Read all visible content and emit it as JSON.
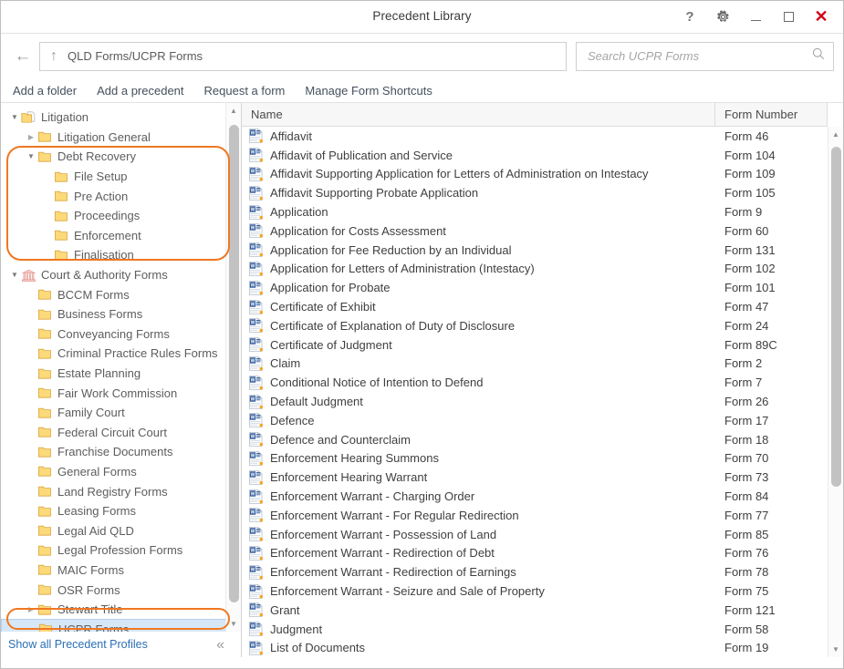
{
  "window": {
    "title": "Precedent Library",
    "buttons": [
      {
        "name": "help",
        "glyph": "?"
      },
      {
        "name": "settings",
        "glyph": "gear"
      },
      {
        "name": "minimize",
        "glyph": "minimize"
      },
      {
        "name": "maximize",
        "glyph": "maximize"
      },
      {
        "name": "close",
        "glyph": "×"
      }
    ],
    "close_color": "#d3061a"
  },
  "address_bar": {
    "back_glyph": "←",
    "up_glyph": "↑",
    "path": "QLD Forms/UCPR Forms"
  },
  "search": {
    "placeholder": "Search UCPR Forms",
    "icon": "search-icon"
  },
  "toolbar": {
    "links": [
      "Add a folder",
      "Add a precedent",
      "Request a form",
      "Manage Form Shortcuts"
    ]
  },
  "sidebar": {
    "footer_link": "Show all Precedent Profiles",
    "collapse_glyph": "«",
    "annotation_color": "#f07722",
    "tree": [
      {
        "label": "Litigation",
        "depth": 0,
        "arrow": "open",
        "icon": "library-folder",
        "selected": false
      },
      {
        "label": "Litigation General",
        "depth": 1,
        "arrow": "closed",
        "icon": "folder",
        "selected": false
      },
      {
        "label": "Debt Recovery",
        "depth": 1,
        "arrow": "open",
        "icon": "folder",
        "selected": false
      },
      {
        "label": "File Setup",
        "depth": 2,
        "arrow": "none",
        "icon": "folder",
        "selected": false
      },
      {
        "label": "Pre Action",
        "depth": 2,
        "arrow": "none",
        "icon": "folder",
        "selected": false
      },
      {
        "label": "Proceedings",
        "depth": 2,
        "arrow": "none",
        "icon": "folder",
        "selected": false
      },
      {
        "label": "Enforcement",
        "depth": 2,
        "arrow": "none",
        "icon": "folder",
        "selected": false
      },
      {
        "label": "Finalisation",
        "depth": 2,
        "arrow": "none",
        "icon": "folder",
        "selected": false
      },
      {
        "label": "Court & Authority Forms",
        "depth": 0,
        "arrow": "open",
        "icon": "courthouse",
        "selected": false
      },
      {
        "label": "BCCM Forms",
        "depth": 1,
        "arrow": "none",
        "icon": "folder",
        "selected": false
      },
      {
        "label": "Business Forms",
        "depth": 1,
        "arrow": "none",
        "icon": "folder",
        "selected": false
      },
      {
        "label": "Conveyancing Forms",
        "depth": 1,
        "arrow": "none",
        "icon": "folder",
        "selected": false
      },
      {
        "label": "Criminal Practice Rules Forms",
        "depth": 1,
        "arrow": "none",
        "icon": "folder",
        "selected": false
      },
      {
        "label": "Estate Planning",
        "depth": 1,
        "arrow": "none",
        "icon": "folder",
        "selected": false
      },
      {
        "label": "Fair Work Commission",
        "depth": 1,
        "arrow": "none",
        "icon": "folder",
        "selected": false
      },
      {
        "label": "Family Court",
        "depth": 1,
        "arrow": "none",
        "icon": "folder",
        "selected": false
      },
      {
        "label": "Federal Circuit Court",
        "depth": 1,
        "arrow": "none",
        "icon": "folder",
        "selected": false
      },
      {
        "label": "Franchise Documents",
        "depth": 1,
        "arrow": "none",
        "icon": "folder",
        "selected": false
      },
      {
        "label": "General Forms",
        "depth": 1,
        "arrow": "none",
        "icon": "folder",
        "selected": false
      },
      {
        "label": "Land Registry Forms",
        "depth": 1,
        "arrow": "none",
        "icon": "folder",
        "selected": false
      },
      {
        "label": "Leasing Forms",
        "depth": 1,
        "arrow": "none",
        "icon": "folder",
        "selected": false
      },
      {
        "label": "Legal Aid QLD",
        "depth": 1,
        "arrow": "none",
        "icon": "folder",
        "selected": false
      },
      {
        "label": "Legal Profession Forms",
        "depth": 1,
        "arrow": "none",
        "icon": "folder",
        "selected": false
      },
      {
        "label": "MAIC Forms",
        "depth": 1,
        "arrow": "none",
        "icon": "folder",
        "selected": false
      },
      {
        "label": "OSR Forms",
        "depth": 1,
        "arrow": "none",
        "icon": "folder",
        "selected": false
      },
      {
        "label": "Stewart Title",
        "depth": 1,
        "arrow": "closed",
        "icon": "folder",
        "selected": false
      },
      {
        "label": "UCPR Forms",
        "depth": 1,
        "arrow": "none",
        "icon": "folder",
        "selected": true
      }
    ]
  },
  "list": {
    "columns": [
      "Name",
      "Form Number"
    ],
    "rows": [
      {
        "name": "Affidavit",
        "form": "Form 46"
      },
      {
        "name": "Affidavit of Publication and Service",
        "form": "Form 104"
      },
      {
        "name": "Affidavit Supporting Application for Letters of Administration on Intestacy",
        "form": "Form 109"
      },
      {
        "name": "Affidavit Supporting Probate Application",
        "form": "Form 105"
      },
      {
        "name": "Application",
        "form": "Form 9"
      },
      {
        "name": "Application for Costs Assessment",
        "form": "Form 60"
      },
      {
        "name": "Application for Fee Reduction by an Individual",
        "form": "Form 131"
      },
      {
        "name": "Application for Letters of Administration (Intestacy)",
        "form": "Form 102"
      },
      {
        "name": "Application for Probate",
        "form": "Form 101"
      },
      {
        "name": "Certificate of Exhibit",
        "form": "Form 47"
      },
      {
        "name": "Certificate of Explanation of Duty of Disclosure",
        "form": "Form 24"
      },
      {
        "name": "Certificate of Judgment",
        "form": "Form 89C"
      },
      {
        "name": "Claim",
        "form": "Form 2"
      },
      {
        "name": "Conditional Notice of Intention to Defend",
        "form": "Form 7"
      },
      {
        "name": "Default Judgment",
        "form": "Form 26"
      },
      {
        "name": "Defence",
        "form": "Form 17"
      },
      {
        "name": "Defence and Counterclaim",
        "form": "Form 18"
      },
      {
        "name": "Enforcement Hearing Summons",
        "form": "Form 70"
      },
      {
        "name": "Enforcement Hearing Warrant",
        "form": "Form 73"
      },
      {
        "name": "Enforcement Warrant - Charging Order",
        "form": "Form 84"
      },
      {
        "name": "Enforcement Warrant - For Regular Redirection",
        "form": "Form 77"
      },
      {
        "name": "Enforcement Warrant - Possession of Land",
        "form": "Form 85"
      },
      {
        "name": "Enforcement Warrant - Redirection of Debt",
        "form": "Form 76"
      },
      {
        "name": "Enforcement Warrant - Redirection of Earnings",
        "form": "Form 78"
      },
      {
        "name": "Enforcement Warrant - Seizure and Sale of Property",
        "form": "Form 75"
      },
      {
        "name": "Grant",
        "form": "Form 121"
      },
      {
        "name": "Judgment",
        "form": "Form 58"
      },
      {
        "name": "List of Documents",
        "form": "Form 19"
      }
    ]
  }
}
